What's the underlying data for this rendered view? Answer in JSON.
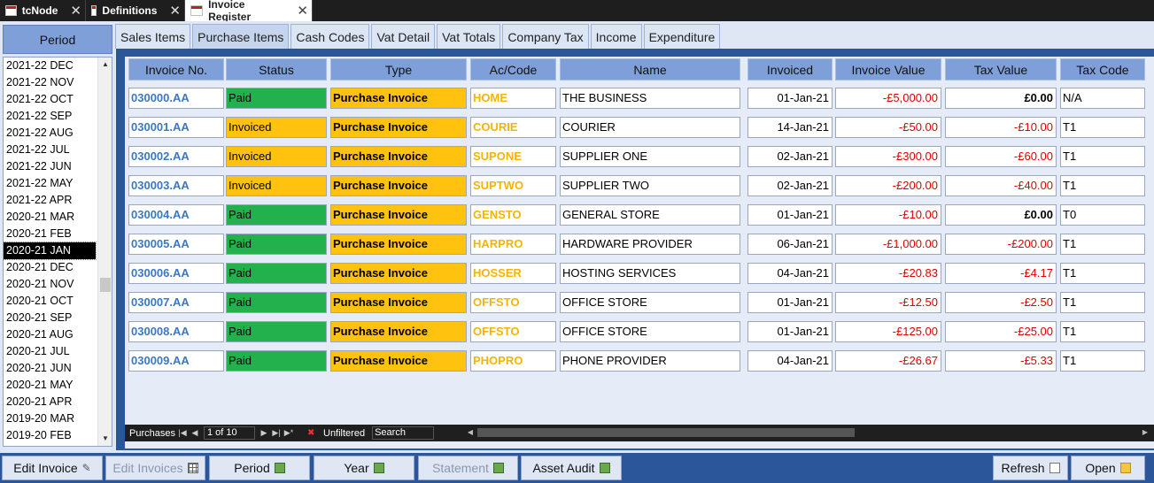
{
  "doc_tabs": [
    {
      "label": "tcNode",
      "active": false
    },
    {
      "label": "Definitions",
      "active": false
    },
    {
      "label": "Invoice Register",
      "active": true
    }
  ],
  "period": {
    "header": "Period",
    "items": [
      "2021-22 DEC",
      "2021-22 NOV",
      "2021-22 OCT",
      "2021-22 SEP",
      "2021-22 AUG",
      "2021-22 JUL",
      "2021-22 JUN",
      "2021-22 MAY",
      "2021-22 APR",
      "2020-21 MAR",
      "2020-21 FEB",
      "2020-21 JAN",
      "2020-21 DEC",
      "2020-21 NOV",
      "2020-21 OCT",
      "2020-21 SEP",
      "2020-21 AUG",
      "2020-21 JUL",
      "2020-21 JUN",
      "2020-21 MAY",
      "2020-21 APR",
      "2019-20 MAR",
      "2019-20 FEB"
    ],
    "selected_index": 11
  },
  "tabs": [
    "Sales Items",
    "Purchase Items",
    "Cash Codes",
    "Vat Detail",
    "Vat Totals",
    "Company Tax",
    "Income",
    "Expenditure"
  ],
  "active_tab": 1,
  "columns": [
    "Invoice No.",
    "Status",
    "Type",
    "Ac/Code",
    "Name",
    "Invoiced",
    "Invoice Value",
    "Tax Value",
    "Tax Code"
  ],
  "rows": [
    {
      "inv": "030000.AA",
      "status": "Paid",
      "type": "Purchase Invoice",
      "code": "HOME",
      "name": "THE BUSINESS",
      "date": "01-Jan-21",
      "value": "-£5,000.00",
      "tax": "£0.00",
      "taxcode": "N/A"
    },
    {
      "inv": "030001.AA",
      "status": "Invoiced",
      "type": "Purchase Invoice",
      "code": "COURIE",
      "name": "COURIER",
      "date": "14-Jan-21",
      "value": "-£50.00",
      "tax": "-£10.00",
      "taxcode": "T1"
    },
    {
      "inv": "030002.AA",
      "status": "Invoiced",
      "type": "Purchase Invoice",
      "code": "SUPONE",
      "name": "SUPPLIER ONE",
      "date": "02-Jan-21",
      "value": "-£300.00",
      "tax": "-£60.00",
      "taxcode": "T1"
    },
    {
      "inv": "030003.AA",
      "status": "Invoiced",
      "type": "Purchase Invoice",
      "code": "SUPTWO",
      "name": "SUPPLIER TWO",
      "date": "02-Jan-21",
      "value": "-£200.00",
      "tax": "-£40.00",
      "taxcode": "T1"
    },
    {
      "inv": "030004.AA",
      "status": "Paid",
      "type": "Purchase Invoice",
      "code": "GENSTO",
      "name": "GENERAL STORE",
      "date": "01-Jan-21",
      "value": "-£10.00",
      "tax": "£0.00",
      "taxcode": "T0"
    },
    {
      "inv": "030005.AA",
      "status": "Paid",
      "type": "Purchase Invoice",
      "code": "HARPRO",
      "name": "HARDWARE PROVIDER",
      "date": "06-Jan-21",
      "value": "-£1,000.00",
      "tax": "-£200.00",
      "taxcode": "T1"
    },
    {
      "inv": "030006.AA",
      "status": "Paid",
      "type": "Purchase Invoice",
      "code": "HOSSER",
      "name": "HOSTING SERVICES",
      "date": "04-Jan-21",
      "value": "-£20.83",
      "tax": "-£4.17",
      "taxcode": "T1"
    },
    {
      "inv": "030007.AA",
      "status": "Paid",
      "type": "Purchase Invoice",
      "code": "OFFSTO",
      "name": "OFFICE STORE",
      "date": "01-Jan-21",
      "value": "-£12.50",
      "tax": "-£2.50",
      "taxcode": "T1"
    },
    {
      "inv": "030008.AA",
      "status": "Paid",
      "type": "Purchase Invoice",
      "code": "OFFSTO",
      "name": "OFFICE STORE",
      "date": "01-Jan-21",
      "value": "-£125.00",
      "tax": "-£25.00",
      "taxcode": "T1"
    },
    {
      "inv": "030009.AA",
      "status": "Paid",
      "type": "Purchase Invoice",
      "code": "PHOPRO",
      "name": "PHONE PROVIDER",
      "date": "04-Jan-21",
      "value": "-£26.67",
      "tax": "-£5.33",
      "taxcode": "T1"
    }
  ],
  "navbar": {
    "label": "Purchases",
    "record": "1 of 10",
    "filter": "Unfiltered",
    "search": "Search"
  },
  "buttons": [
    {
      "label": "Edit Invoice",
      "icon": "pencil-icon",
      "enabled": true
    },
    {
      "label": "Edit Invoices",
      "icon": "grid-icon",
      "enabled": false
    },
    {
      "label": "Period",
      "icon": "report-icon",
      "enabled": true
    },
    {
      "label": "Year",
      "icon": "report-icon",
      "enabled": true
    },
    {
      "label": "Statement",
      "icon": "report-icon",
      "enabled": false
    },
    {
      "label": "Asset Audit",
      "icon": "report-icon",
      "enabled": true
    },
    {
      "label": "Refresh",
      "icon": "refresh-icon",
      "enabled": true
    },
    {
      "label": "Open",
      "icon": "folder-open-icon",
      "enabled": true
    }
  ],
  "colors": {
    "paid": "#22b14c",
    "invoiced": "#ffc20e",
    "type": "#ffc20e",
    "negative": "#e00000",
    "invoice_no": "#3b78c0",
    "code": "#f5b400"
  }
}
